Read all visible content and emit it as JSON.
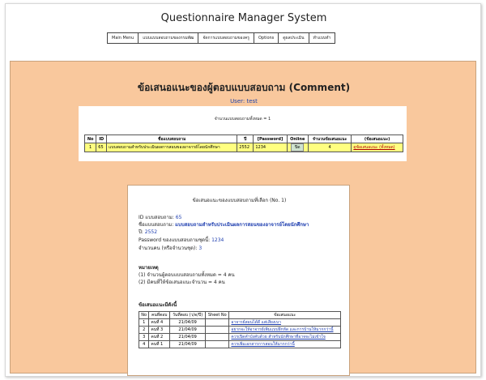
{
  "app": {
    "title": "Questionnaire Manager System"
  },
  "menu": [
    "Main Menu",
    "แบบแบบสอบถามของกรมพัฒ",
    "จัดการแบบสอบถามของครู",
    "Options",
    "ดูผลประเมิน",
    "ทำแบบทำ"
  ],
  "page": {
    "heading": "ข้อเสนอแนะของผู้ตอบแบบสอบถาม (Comment)",
    "user_line": "User: test"
  },
  "summary": {
    "total_line": "จำนวนแบบสอบถามทั้งหมด = 1",
    "columns": [
      "No",
      "ID",
      "ชื่อแบบสอบถาม",
      "ปี",
      "[Password]",
      "Online",
      "จำนวนข้อเสนอแนะ",
      "(ข้อเสนอแนะ)"
    ],
    "rows": [
      {
        "no": "1",
        "id": "65",
        "name": "แบบสอบถามสำหรับประเมินผลการสอนของอาจารย์โดยนักศึกษา",
        "year": "2552",
        "password": "1234",
        "online": "ปิด",
        "count": "4",
        "link": "ดูข้อเสนอแนะ (ทั้งหมด)"
      }
    ]
  },
  "detail": {
    "title": "ข้อเสนอแนะของแบบสอบถามที่เลือก (No. 1)",
    "id_label": "ID แบบสอบถาม:",
    "id_value": "65",
    "name_label": "ชื่อแบบสอบถาม:",
    "name_value": "แบบสอบถามสำหรับประเมินผลการสอนของอาจารย์โดยนักศึกษา",
    "year_label": "ปี:",
    "year_value": "2552",
    "password_label": "Password ของแบบสอบถามชุดนี้:",
    "password_value": "1234",
    "respondents_label": "จำนวนคน (หรือจำนวนชุด):",
    "respondents_value": "3",
    "notes_heading": "หมายเหตุ",
    "note_1": "(1) จำนวนผู้ตอบแบบสอบถามทั้งหมด = 4 คน",
    "note_2": "(2) มีคนที่ให้ข้อเสนอแนะจำนวน = 4 คน",
    "comments_heading": "ข้อเสนอแนะมีดังนี้",
    "comment_columns": [
      "No",
      "คนที่ตอบ",
      "วันที่ตอบ (ว/ด/ปี)",
      "Sheet No",
      "ข้อเสนอแนะ"
    ],
    "comments": [
      {
        "no": "1",
        "who": "คนที่ 4",
        "date": "21/04/09",
        "sheet": "",
        "text": "อาจารย์สอนได้ดี แต่เสียงเบา"
      },
      {
        "no": "2",
        "who": "คนที่ 3",
        "date": "21/04/09",
        "sheet": "",
        "text": "อยากจะให้อาจารย์เพิ่มแบบฝึกหัด และการบ้านให้มากกว่านี้"
      },
      {
        "no": "3",
        "who": "คนที่ 2",
        "date": "21/04/09",
        "sheet": "",
        "text": "ควรเปิดคำบังคับด้วย สำหรับนักศึกษาที่อาจจะไม่เข้าใจ"
      },
      {
        "no": "4",
        "who": "คนที่ 1",
        "date": "21/04/09",
        "sheet": "",
        "text": "ควรเพิ่มเอกสารการสอนให้มากกว่านี้"
      }
    ]
  },
  "colors": {
    "content_bg": "#f9c89d",
    "row_highlight": "#ffff80",
    "link_blue": "#1f3fb0",
    "link_red": "#b00000"
  }
}
